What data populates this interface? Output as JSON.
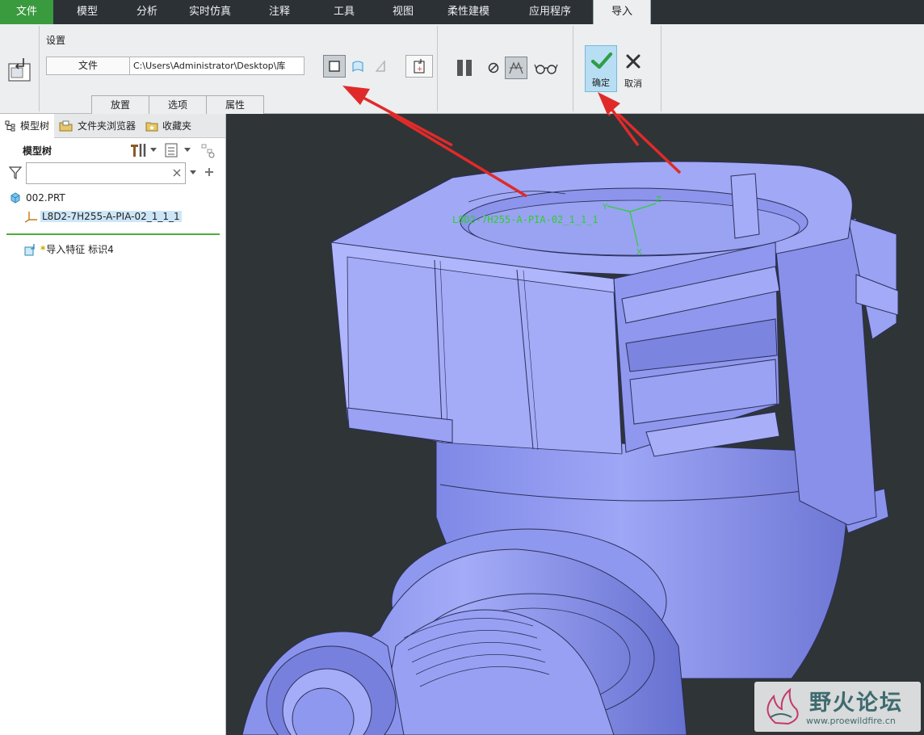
{
  "menu": {
    "tabs": [
      "文件",
      "模型",
      "分析",
      "实时仿真",
      "注释",
      "工具",
      "视图",
      "柔性建模",
      "应用程序",
      "导入"
    ],
    "active": "导入"
  },
  "ribbon": {
    "settings_label": "设置",
    "file_button": "文件",
    "path_value": "C:\\Users\\Administrator\\Desktop\\库",
    "subtabs": [
      "放置",
      "选项",
      "属性"
    ],
    "ok_label": "确定",
    "cancel_label": "取消"
  },
  "left_panel": {
    "tabs": [
      "模型树",
      "文件夹浏览器",
      "收藏夹"
    ],
    "header": "模型树",
    "filter_value": "",
    "items": {
      "part": "002.PRT",
      "csys": "L8D2-7H255-A-PIA-02_1_1_1",
      "feature_marker": "*",
      "feature": "导入特征 标识4"
    }
  },
  "graphics": {
    "csys_label": "L8D2-7H255-A-PIA-02_1_1_1",
    "axis_x": "X",
    "axis_y": "Y",
    "axis_z": "Z"
  },
  "watermark": {
    "title": "野火论坛",
    "url": "www.proewildfire.cn"
  },
  "colors": {
    "file_tab": "#3a9a3e",
    "model_fill": "#8e97ee",
    "ok_highlight": "#b7def3",
    "arrow": "#e02a2a",
    "csys": "#2bd12b"
  }
}
